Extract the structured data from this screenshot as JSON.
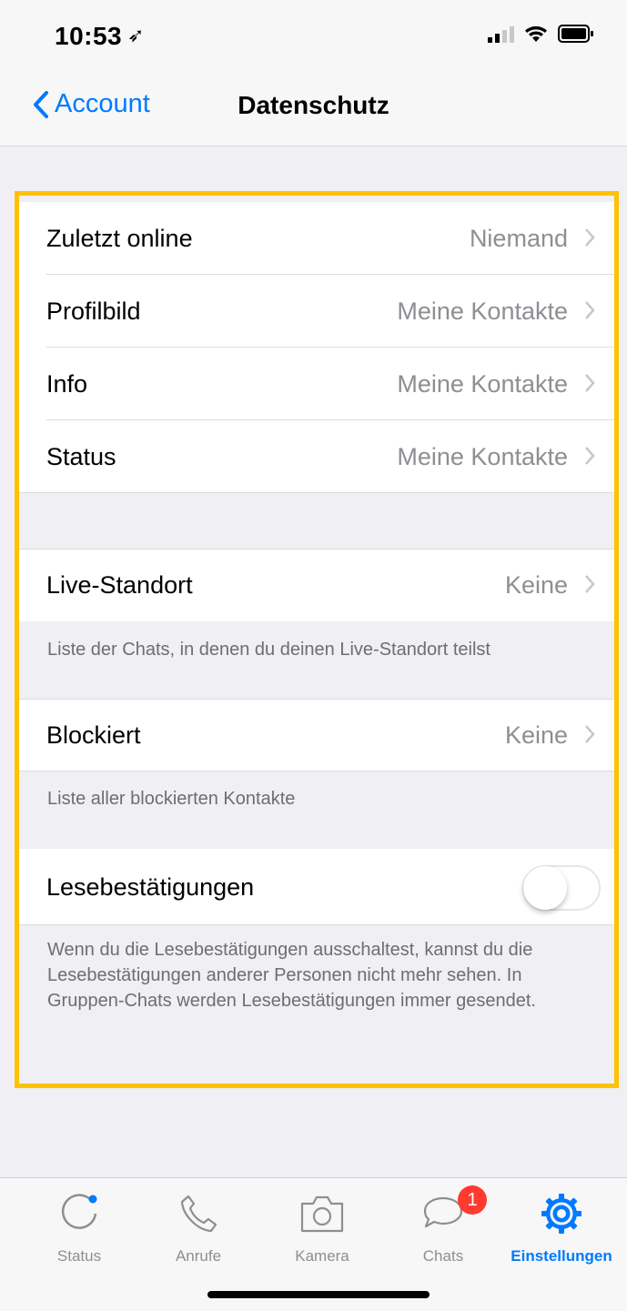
{
  "status_bar": {
    "time": "10:53",
    "location_icon": "location-arrow-icon"
  },
  "nav": {
    "back_label": "Account",
    "title": "Datenschutz"
  },
  "visibility_group": [
    {
      "label": "Zuletzt online",
      "value": "Niemand"
    },
    {
      "label": "Profilbild",
      "value": "Meine Kontakte"
    },
    {
      "label": "Info",
      "value": "Meine Kontakte"
    },
    {
      "label": "Status",
      "value": "Meine Kontakte"
    }
  ],
  "live_location": {
    "label": "Live-Standort",
    "value": "Keine",
    "footer": "Liste der Chats, in denen du deinen Live-Standort teilst"
  },
  "blocked": {
    "label": "Blockiert",
    "value": "Keine",
    "footer": "Liste aller blockierten Kontakte"
  },
  "read_receipts": {
    "label": "Lesebestätigungen",
    "enabled": false,
    "footer": "Wenn du die Lesebestätigungen ausschaltest, kannst du die Lesebestätigungen anderer Personen nicht mehr sehen. In Gruppen-Chats werden Lesebestätigungen immer gesendet."
  },
  "tabs": [
    {
      "label": "Status",
      "icon": "status-icon",
      "active": false
    },
    {
      "label": "Anrufe",
      "icon": "phone-icon",
      "active": false
    },
    {
      "label": "Kamera",
      "icon": "camera-icon",
      "active": false
    },
    {
      "label": "Chats",
      "icon": "chats-icon",
      "active": false,
      "badge": "1"
    },
    {
      "label": "Einstellungen",
      "icon": "gear-icon",
      "active": true
    }
  ],
  "colors": {
    "accent": "#007aff",
    "highlight_border": "#ffc100",
    "badge": "#ff3b30",
    "background": "#efeff4"
  }
}
